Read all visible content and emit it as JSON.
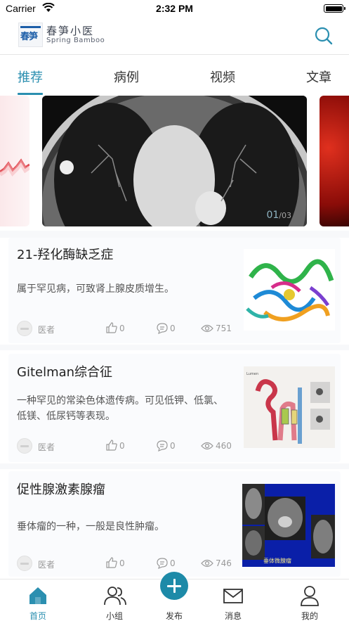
{
  "status_bar": {
    "carrier": "Carrier",
    "time": "2:32 PM"
  },
  "header": {
    "logo_text": "春笋",
    "brand_cn": "春笋小医",
    "brand_en": "Spring Bamboo",
    "search_icon": "search-icon"
  },
  "tabs": [
    {
      "label": "推荐",
      "active": true
    },
    {
      "label": "病例",
      "active": false
    },
    {
      "label": "视频",
      "active": false
    },
    {
      "label": "文章",
      "active": false
    }
  ],
  "banner": {
    "current": "01",
    "total": "/03"
  },
  "cards": [
    {
      "title": "21-羟化酶缺乏症",
      "desc": "属于罕见病，可致肾上腺皮质增生。",
      "author": "医者",
      "likes": "0",
      "comments": "0",
      "views": "751"
    },
    {
      "title": "Gitelman综合征",
      "desc": "一种罕见的常染色体遗传病。可见低钾、低氯、低镁、低尿钙等表现。",
      "author": "医者",
      "likes": "0",
      "comments": "0",
      "views": "460"
    },
    {
      "title": "促性腺激素腺瘤",
      "desc": "垂体瘤的一种，一般是良性肿瘤。",
      "author": "医者",
      "likes": "0",
      "comments": "0",
      "views": "746",
      "thumb_caption": "垂体微腺瘤"
    }
  ],
  "bottom_nav": [
    {
      "label": "首页",
      "icon": "home-icon",
      "active": true
    },
    {
      "label": "小组",
      "icon": "group-icon",
      "active": false
    },
    {
      "label": "发布",
      "icon": "plus-icon",
      "active": false
    },
    {
      "label": "消息",
      "icon": "mail-icon",
      "active": false
    },
    {
      "label": "我的",
      "icon": "user-icon",
      "active": false
    }
  ],
  "colors": {
    "accent": "#2b8fb0",
    "publish": "#1d8aa8"
  }
}
